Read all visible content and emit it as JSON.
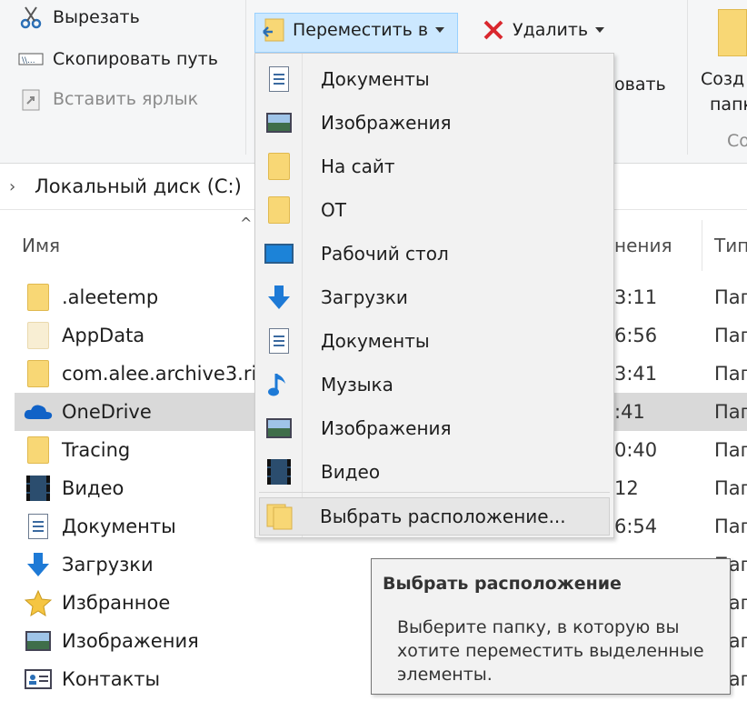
{
  "ribbon": {
    "cut_label": "Вырезать",
    "copy_path_label": "Скопировать путь",
    "paste_shortcut_label": "Вставить ярлык",
    "move_to_label": "Переместить в",
    "delete_label": "Удалить",
    "rename_partial": "овать",
    "new_folder_partial_1": "Созд",
    "new_folder_partial_2": "папк",
    "group_partial": "Со"
  },
  "address": {
    "crumb": "Локальный диск (C:)"
  },
  "columns": {
    "name": "Имя",
    "date_partial": "нения",
    "type_partial": "Тип"
  },
  "files": [
    {
      "name": ".aleetemp",
      "date": "3:11",
      "type": "Пап",
      "icon": "folder-icon"
    },
    {
      "name": "AppData",
      "date": "6:56",
      "type": "Пап",
      "icon": "folder-icon"
    },
    {
      "name": "com.alee.archive3.ric",
      "date": "3:41",
      "type": "Пап",
      "icon": "folder-icon"
    },
    {
      "name": "OneDrive",
      "date": ":41",
      "type": "Пап",
      "icon": "onedrive-icon"
    },
    {
      "name": "Tracing",
      "date": "0:40",
      "type": "Пап",
      "icon": "folder-icon"
    },
    {
      "name": "Видео",
      "date": "12",
      "type": "Пап",
      "icon": "video-icon"
    },
    {
      "name": "Документы",
      "date": "6:54",
      "type": "Пап",
      "icon": "document-icon"
    },
    {
      "name": "Загрузки",
      "date": "",
      "type": "Пап",
      "icon": "download-icon"
    },
    {
      "name": "Избранное",
      "date": "",
      "type": "Пап",
      "icon": "star-icon"
    },
    {
      "name": "Изображения",
      "date": "",
      "type": "Пап",
      "icon": "image-icon"
    },
    {
      "name": "Контакты",
      "date": "",
      "type": "Пап",
      "icon": "contacts-icon"
    }
  ],
  "menu": {
    "items": [
      {
        "label": "Документы",
        "icon": "document-icon"
      },
      {
        "label": "Изображения",
        "icon": "image-icon"
      },
      {
        "label": "На сайт",
        "icon": "folder-icon"
      },
      {
        "label": "ОТ",
        "icon": "folder-icon"
      },
      {
        "label": "Рабочий стол",
        "icon": "desktop-icon"
      },
      {
        "label": "Загрузки",
        "icon": "download-icon"
      },
      {
        "label": "Документы",
        "icon": "document-icon"
      },
      {
        "label": "Музыка",
        "icon": "music-icon"
      },
      {
        "label": "Изображения",
        "icon": "image-icon"
      },
      {
        "label": "Видео",
        "icon": "video-icon"
      }
    ],
    "choose_location": "Выбрать расположение..."
  },
  "tooltip": {
    "title": "Выбрать расположение",
    "body": "Выберите папку, в которую вы хотите переместить выделенные элементы."
  }
}
